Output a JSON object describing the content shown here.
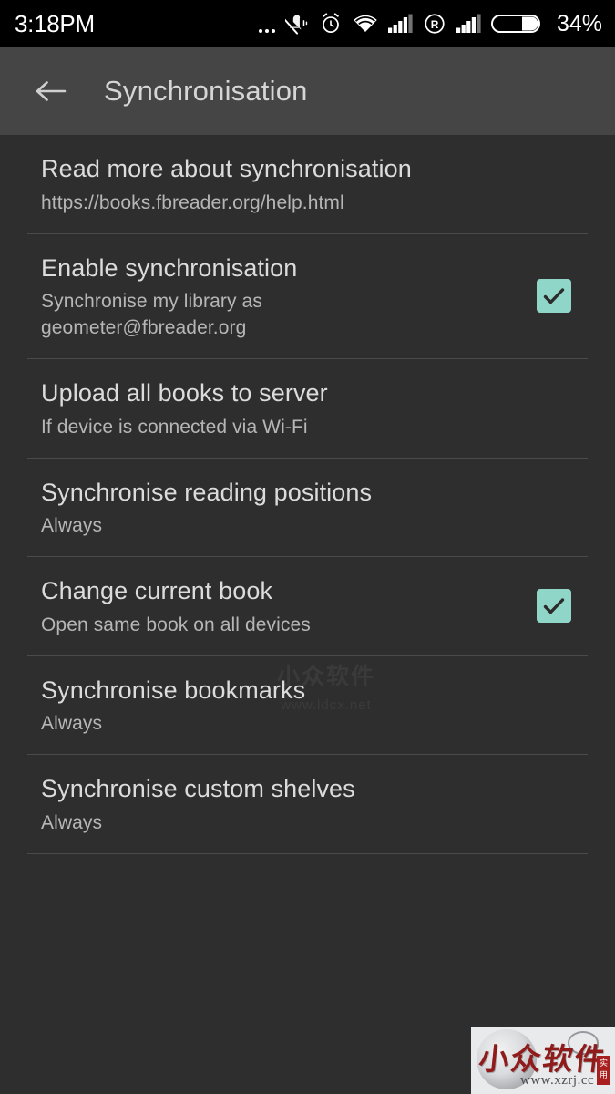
{
  "status_bar": {
    "time": "3:18PM",
    "battery_percent": "34%",
    "icons": [
      "more-options-icon",
      "vibrate-silent-icon",
      "alarm-clock-icon",
      "wifi-icon",
      "cellular-signal-icon",
      "roaming-icon",
      "cellular-signal-2-icon",
      "battery-icon"
    ]
  },
  "app_bar": {
    "back_icon": "back-arrow-icon",
    "title": "Synchronisation"
  },
  "colors": {
    "status_bar_bg": "#000000",
    "app_bar_bg": "#454545",
    "content_bg": "#2e2e2e",
    "divider": "#4a4a4a",
    "title_text": "#dcdcdc",
    "summary_text": "#b6b6b6",
    "checkbox_accent": "#8fd6c8",
    "checkmark": "#2b2b2b"
  },
  "settings": {
    "items": [
      {
        "title": "Read more about synchronisation",
        "summary": "https://books.fbreader.org/help.html",
        "summary_line2": "",
        "has_checkbox": false,
        "checked": false
      },
      {
        "title": "Enable synchronisation",
        "summary": "Synchronise my library as",
        "summary_line2": "geometer@fbreader.org",
        "has_checkbox": true,
        "checked": true
      },
      {
        "title": "Upload all books to server",
        "summary": "If device is connected via Wi-Fi",
        "summary_line2": "",
        "has_checkbox": false,
        "checked": false
      },
      {
        "title": "Synchronise reading positions",
        "summary": "Always",
        "summary_line2": "",
        "has_checkbox": false,
        "checked": false
      },
      {
        "title": "Change current book",
        "summary": "Open same book on all devices",
        "summary_line2": "",
        "has_checkbox": true,
        "checked": true
      },
      {
        "title": "Synchronise bookmarks",
        "summary": "Always",
        "summary_line2": "",
        "has_checkbox": false,
        "checked": false
      },
      {
        "title": "Synchronise custom shelves",
        "summary": "Always",
        "summary_line2": "",
        "has_checkbox": false,
        "checked": false
      }
    ]
  },
  "watermarks": {
    "page_faint_cn": "小众软件",
    "page_faint_url": "www.ldcx.net",
    "logo_cn": "小众软件",
    "logo_url": "www.xzrj.cc",
    "logo_seal": "实用"
  }
}
